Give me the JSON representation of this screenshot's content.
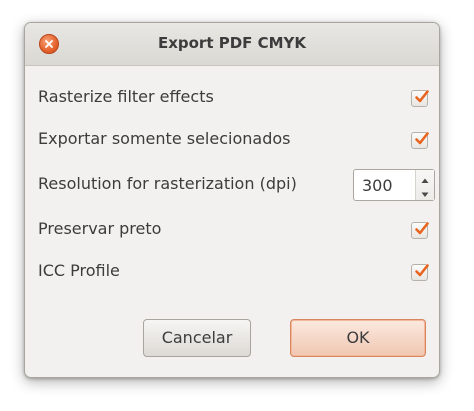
{
  "window": {
    "title": "Export PDF CMYK",
    "close_icon": "close-icon"
  },
  "options": [
    {
      "label": "Rasterize filter effects",
      "checked": true
    },
    {
      "label": "Exportar somente selecionados",
      "checked": true
    },
    {
      "label": "Resolution for rasterization (dpi)",
      "value": "300",
      "type": "spinbutton"
    },
    {
      "label": "Preservar preto",
      "checked": true
    },
    {
      "label": "ICC Profile",
      "checked": true
    }
  ],
  "buttons": {
    "cancel": "Cancelar",
    "ok": "OK"
  },
  "colors": {
    "accent": "#e5622b",
    "checkmark": "#e8641f",
    "background": "#f2f1f0"
  }
}
